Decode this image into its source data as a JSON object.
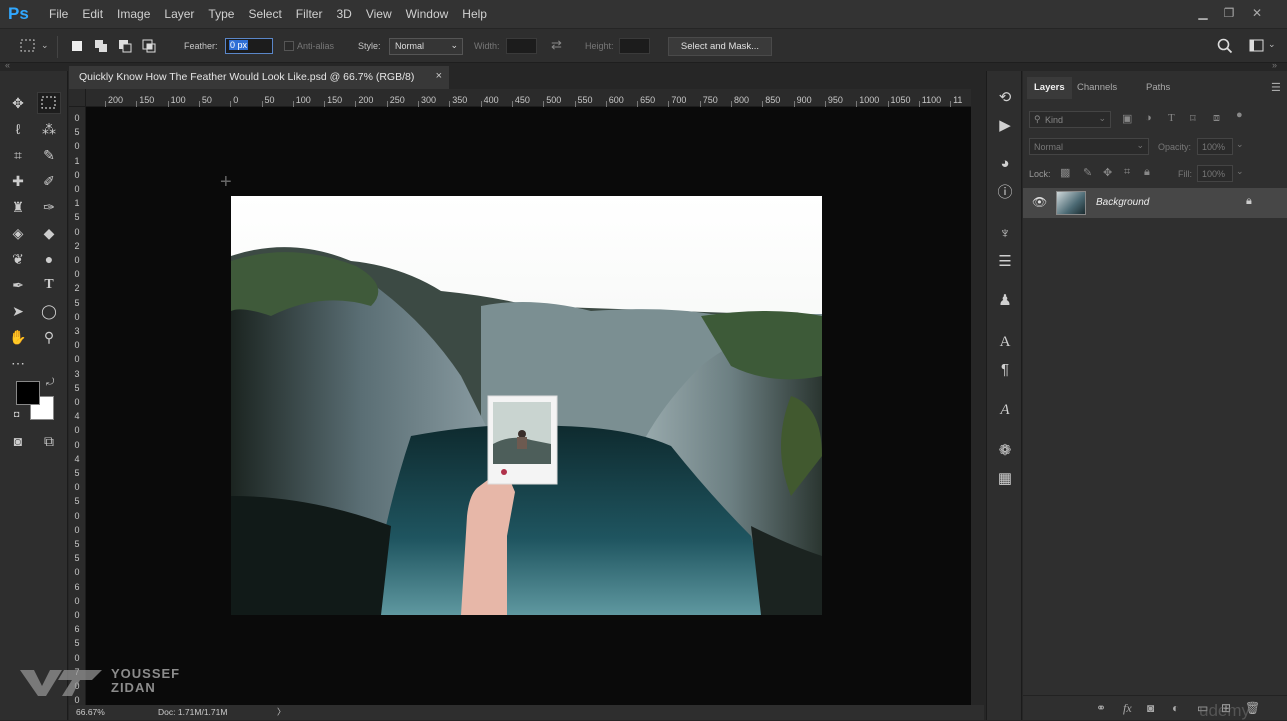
{
  "app": {
    "logo": "Ps"
  },
  "menu": [
    "File",
    "Edit",
    "Image",
    "Layer",
    "Type",
    "Select",
    "Filter",
    "3D",
    "View",
    "Window",
    "Help"
  ],
  "options": {
    "feather_label": "Feather:",
    "feather_value": "0 px",
    "antialias_label": "Anti-alias",
    "style_label": "Style:",
    "style_value": "Normal",
    "width_label": "Width:",
    "height_label": "Height:",
    "select_mask_button": "Select and Mask..."
  },
  "document": {
    "tab_title": "Quickly Know How The Feather Would Look Like.psd @ 66.7% (RGB/8)",
    "close": "×",
    "zoom": "66.67%",
    "doc_info": "Doc: 1.71M/1.71M",
    "status_arrow": "〉"
  },
  "ruler": {
    "h_labels": [
      "200",
      "150",
      "100",
      "50",
      "0",
      "50",
      "100",
      "150",
      "200",
      "250",
      "300",
      "350",
      "400",
      "450",
      "500",
      "550",
      "600",
      "650",
      "700",
      "750",
      "800",
      "850",
      "900",
      "950",
      "1000",
      "1050",
      "1100",
      "11"
    ],
    "v_labels": [
      "0",
      "5",
      "0",
      "1",
      "0",
      "0",
      "1",
      "5",
      "0",
      "2",
      "0",
      "0",
      "2",
      "5",
      "0",
      "3",
      "0",
      "0",
      "3",
      "5",
      "0",
      "4",
      "0",
      "0",
      "4",
      "5",
      "0",
      "5",
      "0",
      "0",
      "5",
      "5",
      "0",
      "6",
      "0",
      "0",
      "6",
      "5",
      "0",
      "7",
      "0",
      "0"
    ]
  },
  "panels": {
    "tabs": [
      "Layers",
      "Channels",
      "Paths"
    ],
    "kind_label": "Kind",
    "blend_mode": "Normal",
    "opacity_label": "Opacity:",
    "opacity_value": "100%",
    "lock_label": "Lock:",
    "fill_label": "Fill:",
    "fill_value": "100%",
    "layer_name": "Background"
  },
  "watermark": {
    "line1": "YOUSSEF",
    "line2": "ZIDAN",
    "corner": "udemy"
  },
  "colors": {
    "accent": "#31a8ff",
    "foreground": "#000000",
    "background": "#ffffff"
  }
}
